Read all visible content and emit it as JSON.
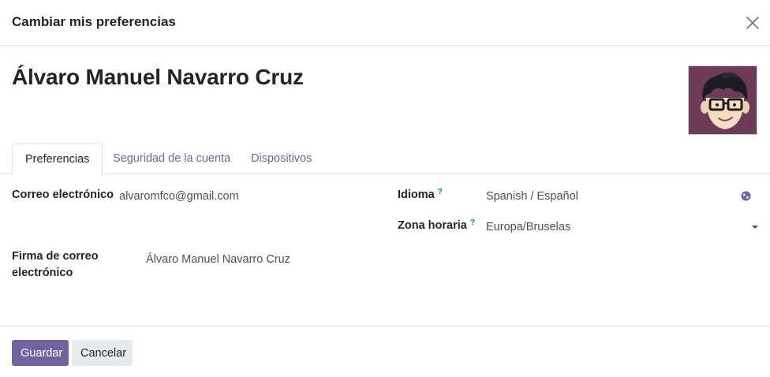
{
  "dialog": {
    "title": "Cambiar mis preferencias"
  },
  "user": {
    "name": "Álvaro Manuel Navarro Cruz"
  },
  "tabs": [
    {
      "label": "Preferencias",
      "active": true
    },
    {
      "label": "Seguridad de la cuenta",
      "active": false
    },
    {
      "label": "Dispositivos",
      "active": false
    }
  ],
  "fields": {
    "email": {
      "label": "Correo electrónico",
      "value": "alvaromfco@gmail.com"
    },
    "language": {
      "label": "Idioma",
      "help": "?",
      "value": "Spanish / Español"
    },
    "timezone": {
      "label": "Zona horaria",
      "help": "?",
      "value": "Europa/Bruselas"
    },
    "signature": {
      "label_line1": "Firma de correo",
      "label_line2": "electrónico",
      "value": "Álvaro Manuel Navarro Cruz"
    }
  },
  "footer": {
    "save_label": "Guardar",
    "cancel_label": "Cancelar"
  },
  "colors": {
    "primary": "#71639e",
    "help": "#017e84"
  },
  "icons": {
    "close": "close-icon",
    "globe": "globe-icon",
    "caret": "chevron-down-icon"
  }
}
